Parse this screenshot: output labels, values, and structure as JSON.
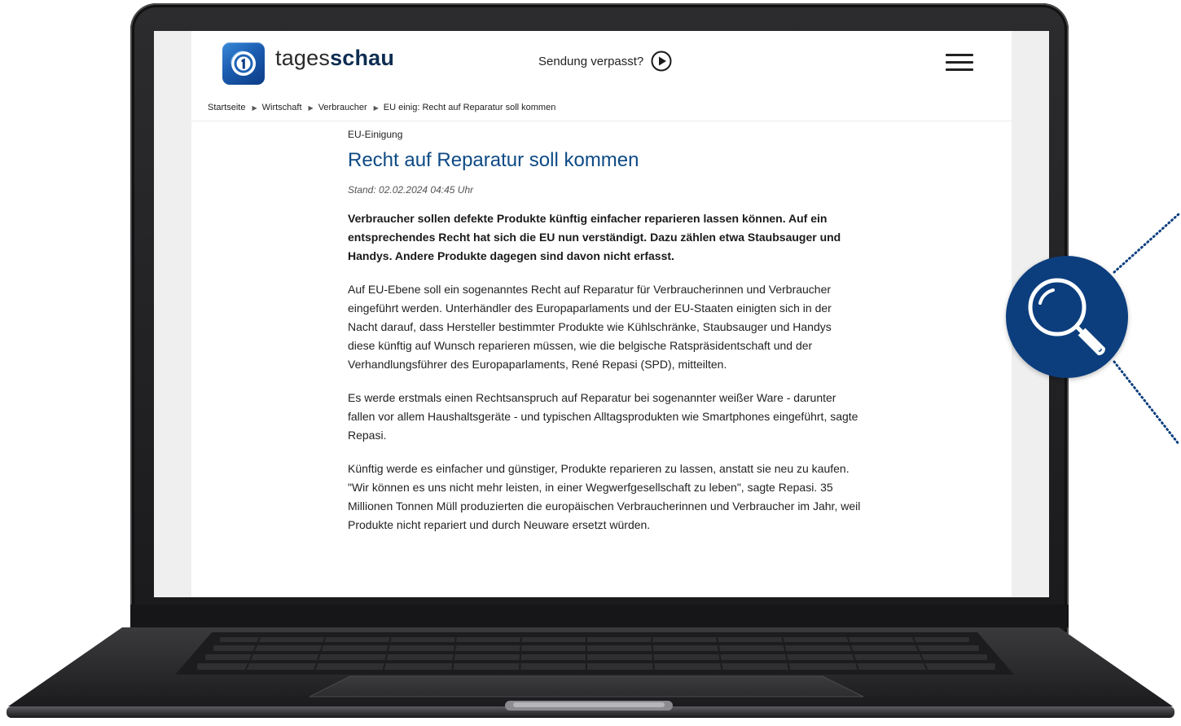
{
  "site": {
    "brand_light": "tages",
    "brand_bold": "schau",
    "missed_label": "Sendung verpasst?"
  },
  "breadcrumb": {
    "items": [
      "Startseite",
      "Wirtschaft",
      "Verbraucher",
      "EU einig: Recht auf Reparatur soll kommen"
    ]
  },
  "article": {
    "kicker": "EU-Einigung",
    "headline": "Recht auf Reparatur soll kommen",
    "stand": "Stand: 02.02.2024 04:45 Uhr",
    "teaser": "Verbraucher sollen defekte Produkte künftig einfacher reparieren lassen können. Auf ein entsprechendes Recht hat sich die EU nun verständigt. Dazu zählen etwa Staubsauger und Handys. Andere Produkte dagegen sind davon nicht erfasst.",
    "paragraphs": [
      "Auf EU-Ebene soll ein sogenanntes Recht auf Reparatur für Verbraucherinnen und Verbraucher eingeführt werden. Unterhändler des Europaparlaments und der EU-Staaten einigten sich in der Nacht darauf, dass Hersteller bestimmter Produkte wie Kühlschränke, Staubsauger und Handys diese künftig auf Wunsch reparieren müssen, wie die belgische Ratspräsidentschaft und der Verhandlungsführer des Europaparlaments, René Repasi (SPD), mitteilten.",
      "Es werde erstmals einen Rechtsanspruch auf Reparatur bei sogenannter weißer Ware - darunter fallen vor allem Haushaltsgeräte - und typischen Alltagsprodukten wie Smartphones eingeführt, sagte Repasi.",
      "Künftig werde es einfacher und günstiger, Produkte reparieren zu lassen, anstatt sie neu zu kaufen. \"Wir können es uns nicht mehr leisten, in einer Wegwerfgesellschaft zu leben\", sagte Repasi. 35 Millionen Tonnen Müll produzierten die europäischen Verbraucherinnen und Verbraucher im Jahr, weil Produkte nicht repariert und durch Neuware ersetzt würden."
    ]
  },
  "icons": {
    "logo": "tagesschau-logo-icon",
    "play": "play-circle-icon",
    "menu": "hamburger-menu-icon",
    "breadcrumb_separator": "triangle-right-icon",
    "magnifier": "magnifying-glass-icon"
  },
  "colors": {
    "headline": "#0d4a85",
    "brand_dark": "#0d2d52",
    "magnifier_badge": "#0c3e7e",
    "screen_margin": "#efefef"
  }
}
